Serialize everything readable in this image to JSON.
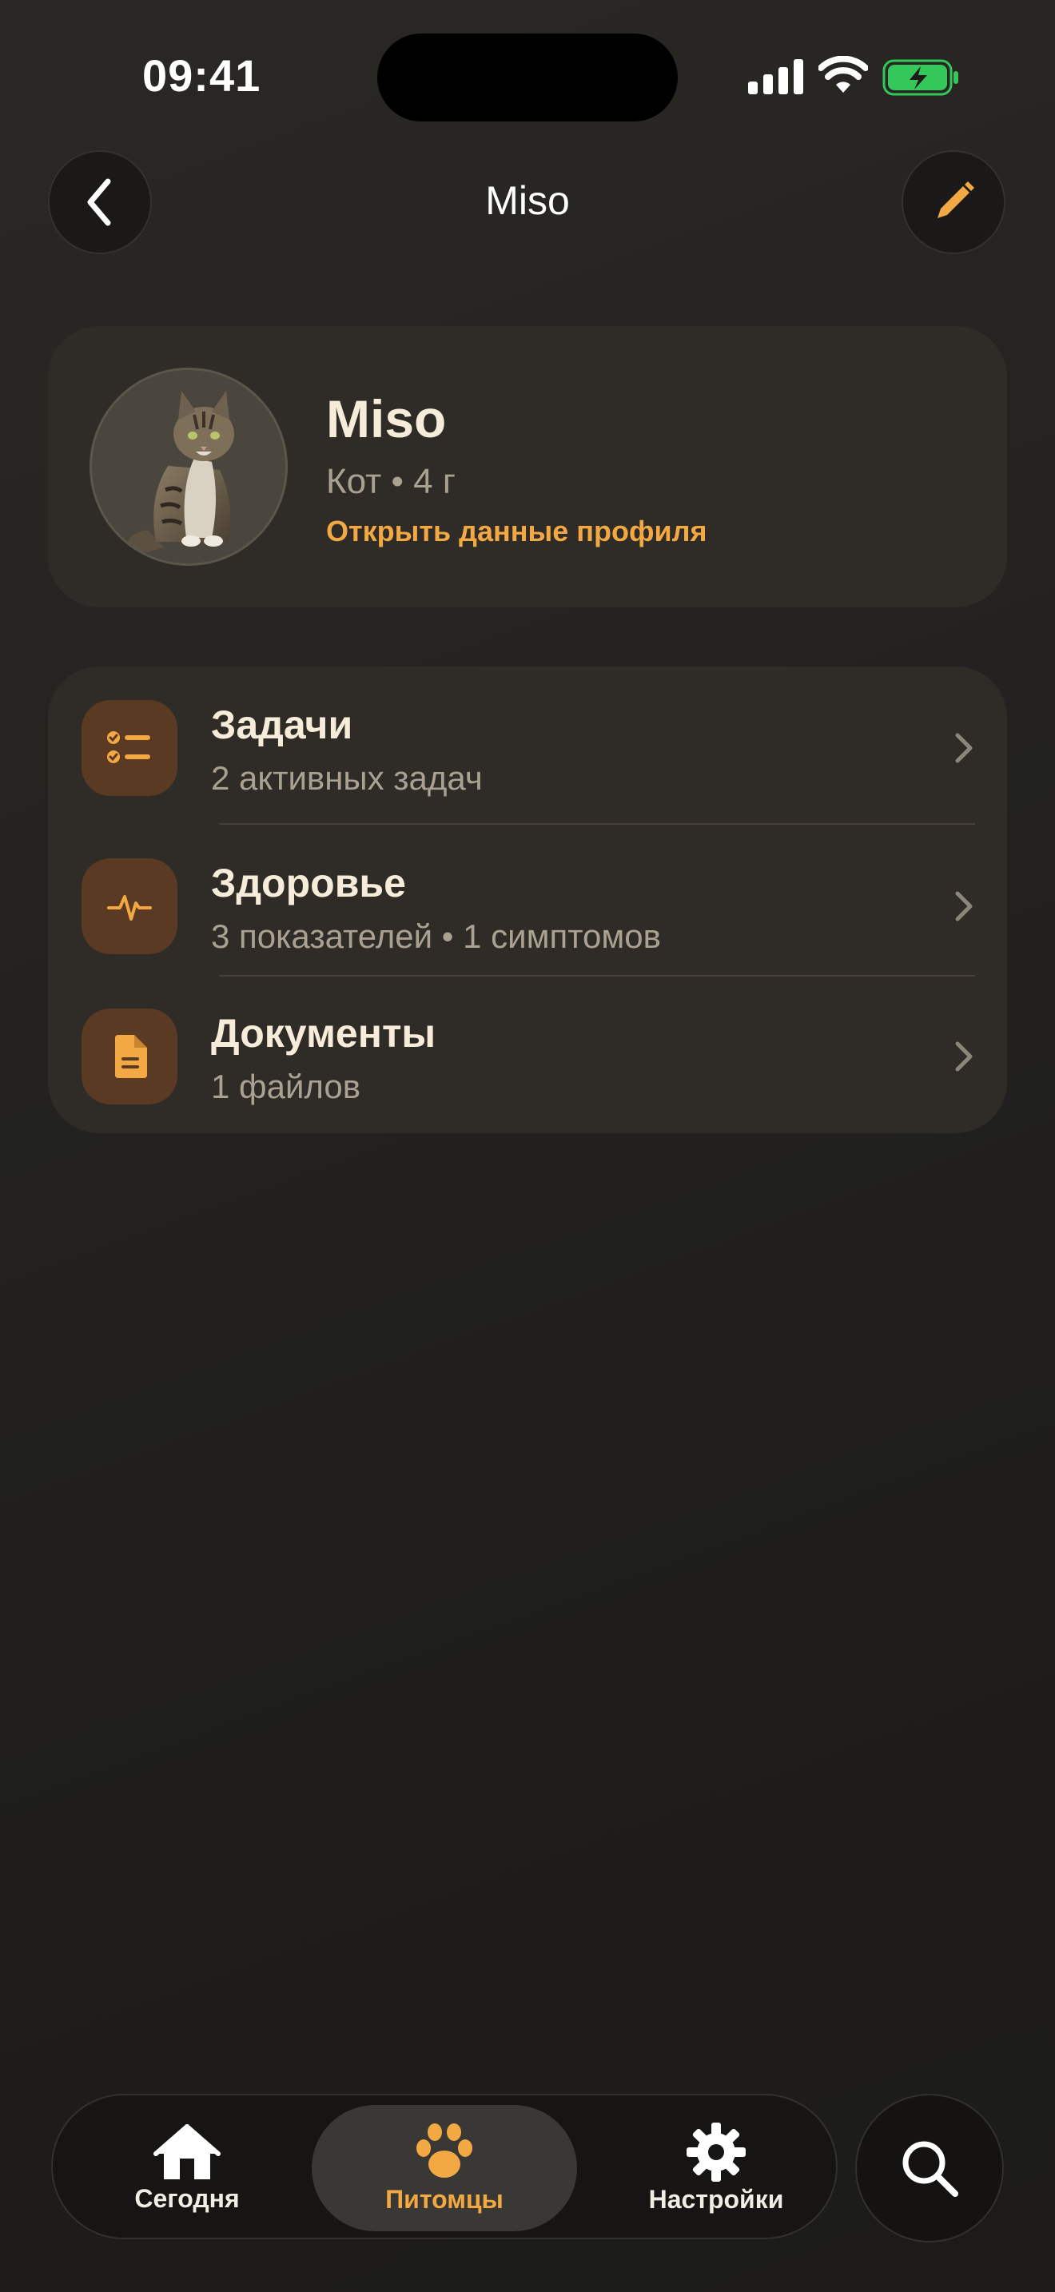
{
  "status_bar": {
    "time": "09:41"
  },
  "nav": {
    "title": "Miso",
    "back_icon": "chevron-left-icon",
    "edit_icon": "pencil-icon"
  },
  "profile": {
    "name": "Miso",
    "meta": "Кот • 4 г",
    "link": "Открыть данные профиля"
  },
  "menu": [
    {
      "title": "Задачи",
      "subtitle": "2 активных задач",
      "icon": "checklist-icon"
    },
    {
      "title": "Здоровье",
      "subtitle": "3 показателей • 1 симптомов",
      "icon": "heartbeat-icon"
    },
    {
      "title": "Документы",
      "subtitle": "1 файлов",
      "icon": "document-icon"
    }
  ],
  "tabbar": {
    "tabs": [
      {
        "label": "Сегодня",
        "icon": "home-icon",
        "active": false
      },
      {
        "label": "Питомцы",
        "icon": "paw-icon",
        "active": true
      },
      {
        "label": "Настройки",
        "icon": "gear-icon",
        "active": false
      }
    ],
    "search_icon": "search-icon"
  },
  "colors": {
    "accent": "#f2a843",
    "card": "#2f2c27",
    "icon_box": "#5a3a22",
    "battery_green": "#34c759"
  }
}
